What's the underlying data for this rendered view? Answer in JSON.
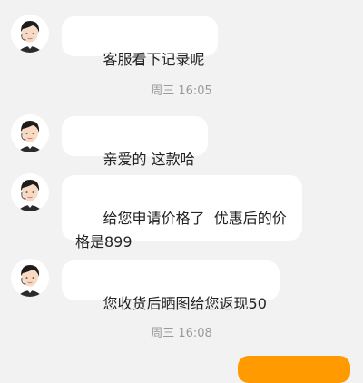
{
  "messages": [
    {
      "sender": "agent",
      "text": "客服看下记录呢"
    },
    {
      "sender": "agent",
      "text": "亲爱的 这款哈"
    },
    {
      "sender": "agent",
      "text": "给您申请价格了  优惠后的价格是899"
    },
    {
      "sender": "agent",
      "text": "您收货后晒图给您返现50"
    }
  ],
  "timestamps": [
    "周三 16:05",
    "周三 16:08"
  ],
  "colors": {
    "background": "#f2f2f2",
    "bubble_incoming": "#ffffff",
    "bubble_outgoing": "#ff9a00",
    "timestamp_text": "#9a9a9a"
  },
  "icons": {
    "avatar": "agent-avatar-icon"
  }
}
